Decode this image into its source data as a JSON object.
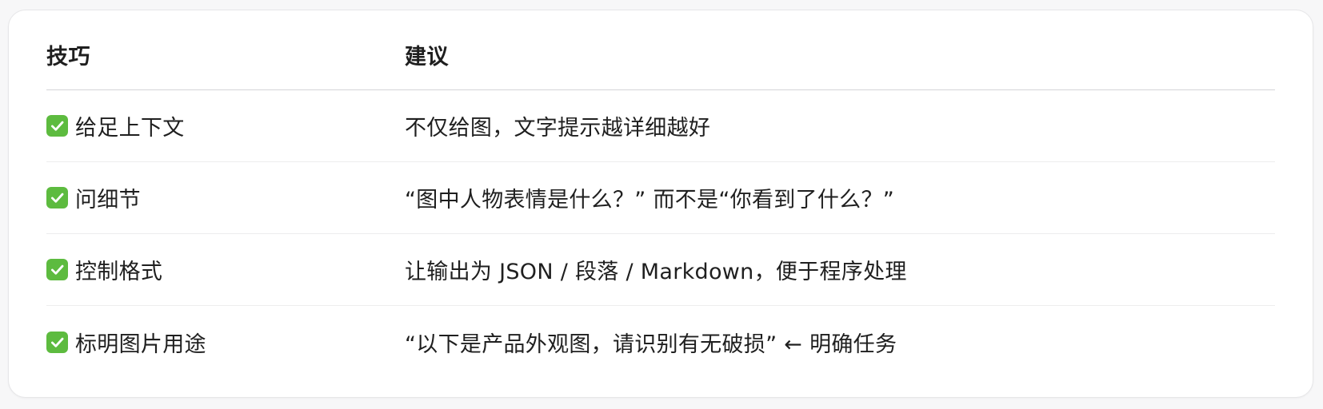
{
  "table": {
    "headers": {
      "col1": "技巧",
      "col2": "建议"
    },
    "rows": [
      {
        "icon": "check-mark-icon",
        "tip": "给足上下文",
        "advice": "不仅给图，文字提示越详细越好"
      },
      {
        "icon": "check-mark-icon",
        "tip": "问细节",
        "advice": "“图中人物表情是什么？” 而不是“你看到了什么？”"
      },
      {
        "icon": "check-mark-icon",
        "tip": "控制格式",
        "advice": "让输出为 JSON / 段落 / Markdown，便于程序处理"
      },
      {
        "icon": "check-mark-icon",
        "tip": "标明图片用途",
        "advice": "“以下是产品外观图，请识别有无破损” ← 明确任务"
      }
    ]
  },
  "colors": {
    "check_background": "#5dbb3f",
    "divider": "#d4d4d7",
    "text": "#1f1f1f",
    "card_background": "#ffffff"
  }
}
